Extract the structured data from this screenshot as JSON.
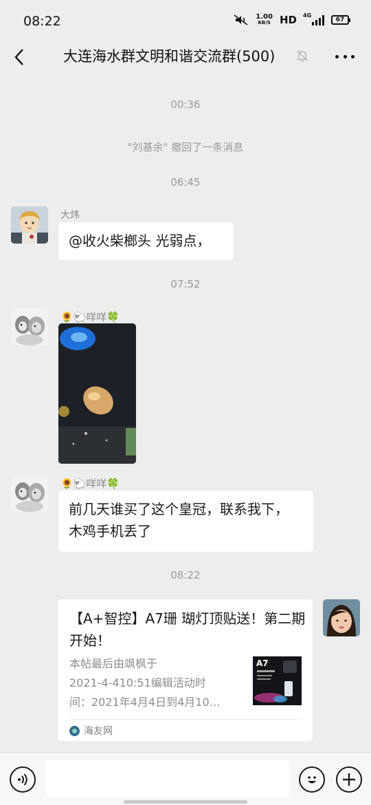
{
  "status_bar": {
    "time": "08:22",
    "net_speed_value": "1.00",
    "net_speed_unit": "KB/S",
    "hd_label": "HD",
    "network": "4G",
    "battery": "67"
  },
  "header": {
    "title": "大连海水群文明和谐交流群(500)",
    "muted": true
  },
  "chat": {
    "time_1": "00:36",
    "recall_notice": "\"刘基余\" 撤回了一条消息",
    "time_2": "06:45",
    "msg_1": {
      "sender": "大炜",
      "text": "@收火柴榔头  光弱点，"
    },
    "time_3": "07:52",
    "msg_2": {
      "sender": "🌻🐑咩咩🍀"
    },
    "msg_3": {
      "sender": "🌻🐑咩咩🍀",
      "text_line1": "前几天谁买了这个皇冠，联系我下，",
      "text_line2": "木鸡手机丢了"
    },
    "time_4": "08:22",
    "link_card": {
      "title": "【A+智控】A7珊 瑚灯顶贴送！第二期开始！",
      "desc": "本帖最后由飒枫于\n2021-4-410:51编辑活动时\n间：2021年4月4日到4月10…",
      "thumb_label": "A7",
      "source": "海友网"
    }
  },
  "input_bar": {
    "placeholder": ""
  },
  "colors": {
    "background": "#ededed",
    "bubble": "#ffffff",
    "system_text": "#9b9b9b"
  }
}
